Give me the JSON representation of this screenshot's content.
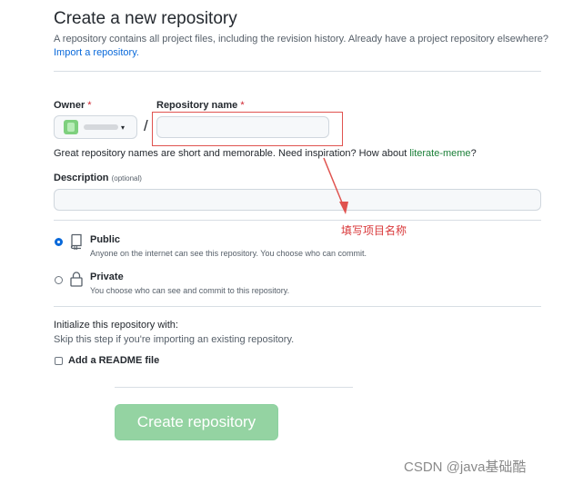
{
  "header": {
    "title": "Create a new repository",
    "subtitle": "A repository contains all project files, including the revision history. Already have a project repository elsewhere?",
    "import_link": "Import a repository."
  },
  "owner": {
    "label": "Owner",
    "required_mark": "*",
    "caret": "▾"
  },
  "separator": "/",
  "repo_name": {
    "label": "Repository name",
    "required_mark": "*",
    "value": ""
  },
  "hint": {
    "text": "Great repository names are short and memorable. Need inspiration? How about ",
    "suggestion": "literate-meme",
    "suffix": "?"
  },
  "description": {
    "label": "Description",
    "optional": "(optional)",
    "value": ""
  },
  "annotation": {
    "text": "填写项目名称",
    "color": "#d9383a"
  },
  "visibility": {
    "selected": "public",
    "options": [
      {
        "title": "Public",
        "desc": "Anyone on the internet can see this repository. You choose who can commit."
      },
      {
        "title": "Private",
        "desc": "You choose who can see and commit to this repository."
      }
    ]
  },
  "initialize": {
    "title": "Initialize this repository with:",
    "desc": "Skip this step if you're importing an existing repository.",
    "readme_label": "Add a README file",
    "readme_checked": false
  },
  "submit": {
    "label": "Create repository",
    "color": "#94d3a2"
  },
  "watermark": "CSDN @java基础酷",
  "colors": {
    "link": "#0969da",
    "suggestion": "#1a7f37",
    "required": "#cf222e"
  }
}
